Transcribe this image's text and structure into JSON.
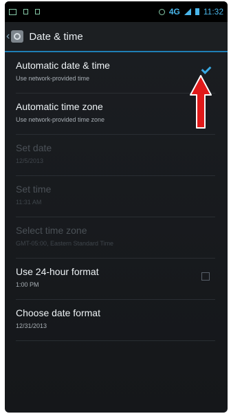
{
  "status_bar": {
    "time": "11:32",
    "network": "4G"
  },
  "action_bar": {
    "title": "Date & time"
  },
  "settings": [
    {
      "label": "Automatic date & time",
      "sub": "Use network-provided time",
      "state": "checked"
    },
    {
      "label": "Automatic time zone",
      "sub": "Use network-provided time zone",
      "state": "none"
    },
    {
      "label": "Set date",
      "sub": "12/5/2013",
      "state": "disabled"
    },
    {
      "label": "Set time",
      "sub": "11:31 AM",
      "state": "disabled"
    },
    {
      "label": "Select time zone",
      "sub": "GMT-05:00, Eastern Standard Time",
      "state": "disabled"
    },
    {
      "label": "Use 24-hour format",
      "sub": "1:00 PM",
      "state": "unchecked"
    },
    {
      "label": "Choose date format",
      "sub": "12/31/2013",
      "state": "none"
    }
  ],
  "colors": {
    "accent": "#38a9e3",
    "arrow": "#e01a1a"
  },
  "icons": [
    "notification-icon",
    "wifi-icon",
    "sim-icon",
    "alarm-icon",
    "signal-icon",
    "battery-icon",
    "back-chevron-icon",
    "gear-icon",
    "checkmark-icon",
    "red-arrow-icon"
  ]
}
